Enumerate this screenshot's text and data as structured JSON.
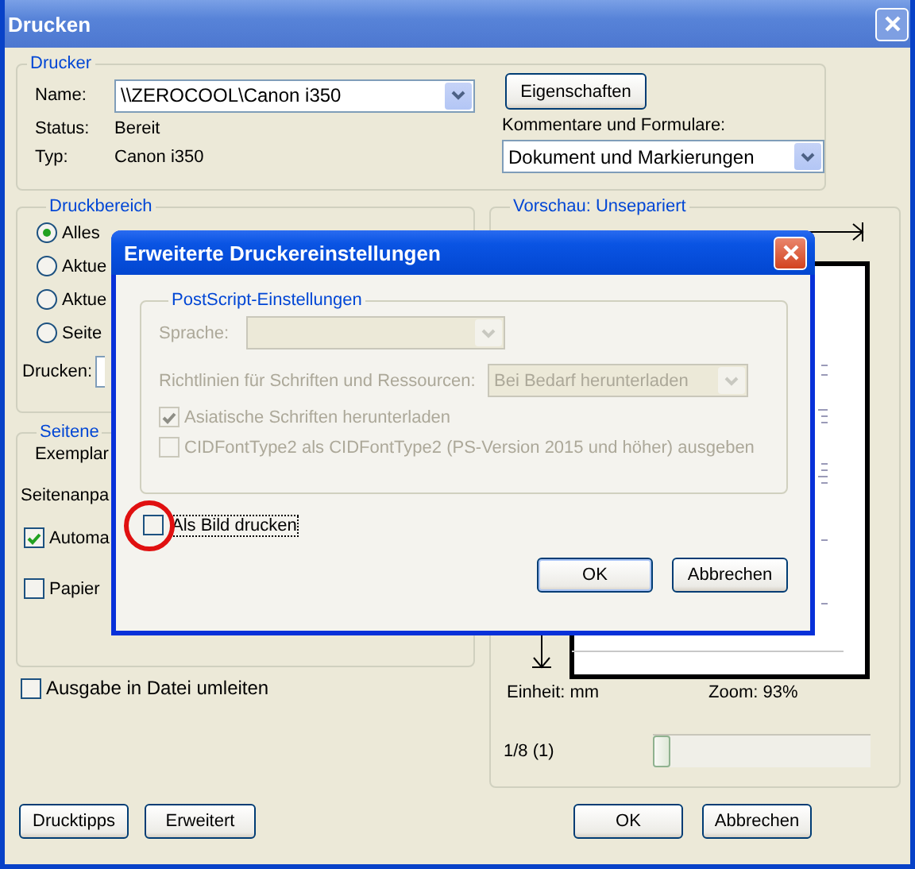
{
  "window": {
    "title": "Drucken"
  },
  "printer": {
    "legend": "Drucker",
    "name_label": "Name:",
    "name_value": "\\\\ZEROCOOL\\Canon i350",
    "status_label": "Status:",
    "status_value": "Bereit",
    "type_label": "Typ:",
    "type_value": "Canon i350",
    "properties_button": "Eigenschaften",
    "comments_label": "Kommentare und Formulare:",
    "comments_value": "Dokument und Markierungen"
  },
  "print_range": {
    "legend": "Druckbereich",
    "options": [
      {
        "label": "Alles",
        "selected": true
      },
      {
        "label": "Aktue",
        "selected": false
      },
      {
        "label": "Aktue",
        "selected": false
      },
      {
        "label": "Seite",
        "selected": false
      }
    ],
    "print_label": "Drucken:"
  },
  "page_setup": {
    "legend": "Seitene",
    "copies_label": "Exemplar",
    "scaling_label": "Seitenanpa",
    "checkboxes": [
      {
        "label": "Automa",
        "checked": true
      },
      {
        "label": "Papier",
        "checked": false
      }
    ]
  },
  "print_to_file": {
    "label": "Ausgabe in Datei umleiten",
    "checked": false
  },
  "preview": {
    "legend": "Vorschau: Unsepariert",
    "unit": "Einheit: mm",
    "zoom": "Zoom:  93%",
    "page": "1/8 (1)",
    "slider": {
      "level": 0
    }
  },
  "buttons_left": [
    "Drucktipps",
    "Erweitert"
  ],
  "buttons_right": [
    "OK",
    "Abbrechen"
  ],
  "dialog": {
    "title": "Erweiterte Druckereinstellungen",
    "group": {
      "legend": "PostScript-Einstellungen",
      "language_label": "Sprache:",
      "font_policy_label": "Richtlinien für Schriften und Ressourcen:",
      "font_policy_value": "Bei Bedarf herunterladen",
      "checkboxes": [
        {
          "label": "Asiatische Schriften herunterladen",
          "checked": true,
          "disabled": true
        },
        {
          "label": "CIDFontType2 als CIDFontType2 (PS-Version 2015 und höher) ausgeben",
          "checked": false,
          "disabled": true
        }
      ]
    },
    "print_as_image": {
      "label": "Als Bild drucken",
      "checked": false,
      "focused": true,
      "highlighted": true
    },
    "buttons": [
      "OK",
      "Abbrechen"
    ]
  }
}
